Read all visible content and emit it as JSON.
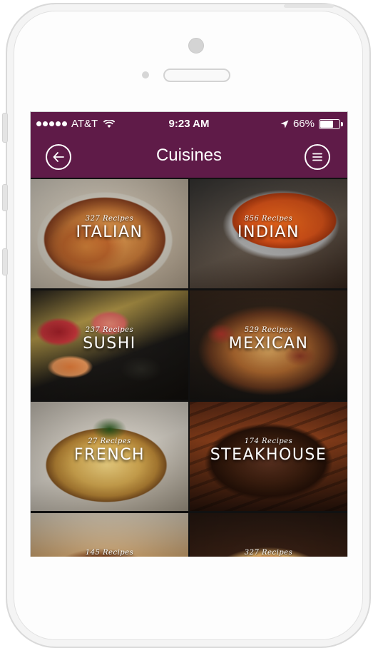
{
  "status_bar": {
    "carrier": "AT&T",
    "time": "9:23 AM",
    "battery_pct": "66%",
    "battery_level": 0.66
  },
  "navbar": {
    "title": "Cuisines",
    "back_icon": "back-arrow-circle-icon",
    "menu_icon": "hamburger-menu-circle-icon"
  },
  "cuisines": [
    {
      "name": "ITALIAN",
      "count": "327 Recipes"
    },
    {
      "name": "INDIAN",
      "count": "856 Recipes"
    },
    {
      "name": "SUSHI",
      "count": "237 Recipes"
    },
    {
      "name": "MEXICAN",
      "count": "529 Recipes"
    },
    {
      "name": "FRENCH",
      "count": "27 Recipes"
    },
    {
      "name": "STEAKHOUSE",
      "count": "174 Recipes"
    },
    {
      "name": "",
      "count": "145 Recipes"
    },
    {
      "name": "",
      "count": "327 Recipes"
    }
  ],
  "colors": {
    "brand": "#5f1b48",
    "text_on_brand": "#ffffff"
  }
}
